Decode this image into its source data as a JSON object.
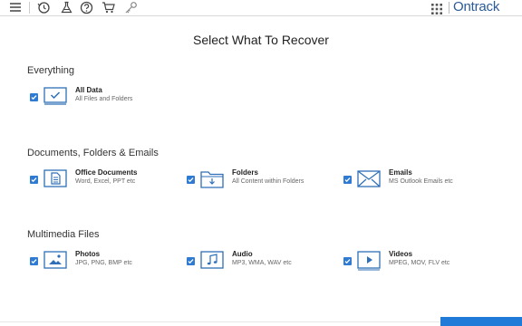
{
  "brand": "Ontrack",
  "toolbar_icons": [
    "menu-icon",
    "history-icon",
    "flask-icon",
    "help-icon",
    "cart-icon",
    "key-icon"
  ],
  "page_title": "Select What To Recover",
  "colors": {
    "accent": "#2f7bd3",
    "brand": "#2b5a97",
    "scan_button": "#1f7ad8"
  },
  "sections": [
    {
      "title": "Everything",
      "items": [
        {
          "label": "All Data",
          "sub": "All Files and Folders",
          "checked": true,
          "icon": "checkmark-square-icon"
        }
      ]
    },
    {
      "title": "Documents, Folders & Emails",
      "items": [
        {
          "label": "Office Documents",
          "sub": "Word, Excel, PPT etc",
          "checked": true,
          "icon": "document-icon"
        },
        {
          "label": "Folders",
          "sub": "All Content within Folders",
          "checked": true,
          "icon": "folder-icon"
        },
        {
          "label": "Emails",
          "sub": "MS Outlook Emails etc",
          "checked": true,
          "icon": "email-icon"
        }
      ]
    },
    {
      "title": "Multimedia Files",
      "items": [
        {
          "label": "Photos",
          "sub": "JPG, PNG, BMP etc",
          "checked": true,
          "icon": "photo-icon"
        },
        {
          "label": "Audio",
          "sub": "MP3, WMA, WAV etc",
          "checked": true,
          "icon": "music-note-icon"
        },
        {
          "label": "Videos",
          "sub": "MPEG, MOV, FLV etc",
          "checked": true,
          "icon": "video-play-icon"
        }
      ]
    }
  ]
}
